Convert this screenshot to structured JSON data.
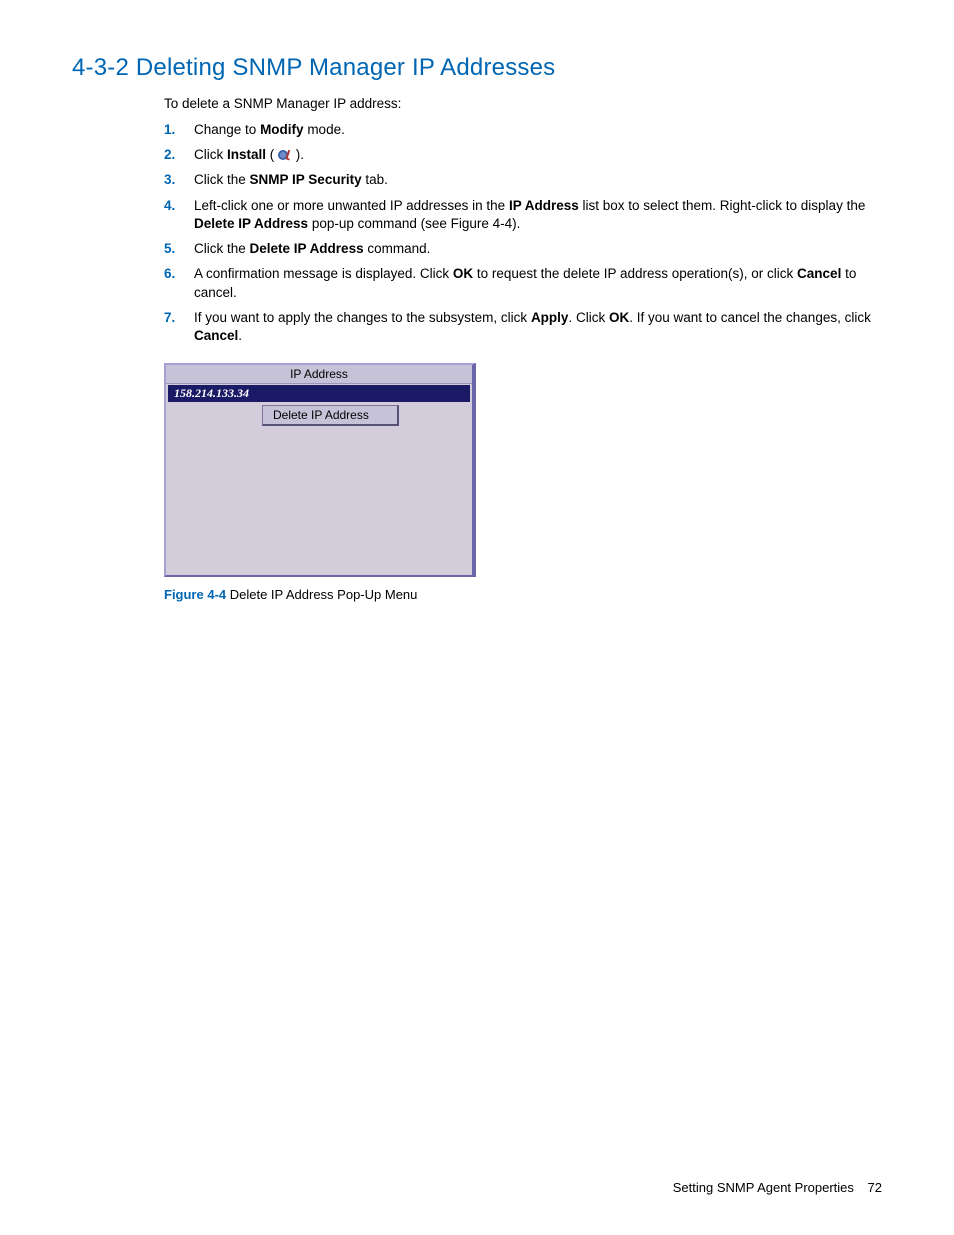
{
  "heading": "4-3-2 Deleting SNMP Manager IP Addresses",
  "intro": "To delete a SNMP Manager IP address:",
  "steps": [
    {
      "n": "1.",
      "pre": "Change to ",
      "b1": "Modify",
      "post": " mode."
    },
    {
      "n": "2.",
      "pre": "Click ",
      "b1": "Install",
      "mid": " ( ",
      "icon": true,
      "post": " )."
    },
    {
      "n": "3.",
      "pre": "Click the ",
      "b1": "SNMP IP Security",
      "post": " tab."
    },
    {
      "n": "4.",
      "pre": "Left-click one or more unwanted IP addresses in the ",
      "b1": "IP Address",
      "mid": " list box to select them. Right-click to display the ",
      "b2": "Delete IP Address",
      "post": " pop-up command (see Figure 4-4)."
    },
    {
      "n": "5.",
      "pre": "Click the ",
      "b1": "Delete IP Address",
      "post": " command."
    },
    {
      "n": "6.",
      "pre": "A confirmation message is displayed. Click ",
      "b1": "OK",
      "mid": " to request the delete IP address operation(s), or click ",
      "b2": "Cancel",
      "post": " to cancel."
    },
    {
      "n": "7.",
      "pre": "If you want to apply the changes to the subsystem, click ",
      "b1": "Apply",
      "mid": ". Click ",
      "b2": "OK",
      "mid2": ". If you want to cancel the changes, click ",
      "b3": "Cancel",
      "post": "."
    }
  ],
  "dialog": {
    "header": "IP Address",
    "row": "158.214.133.34",
    "popup": "Delete IP Address"
  },
  "figure": {
    "label": "Figure 4-4",
    "caption": " Delete IP Address Pop-Up Menu"
  },
  "footer": {
    "section": "Setting SNMP Agent Properties",
    "page": "72"
  }
}
